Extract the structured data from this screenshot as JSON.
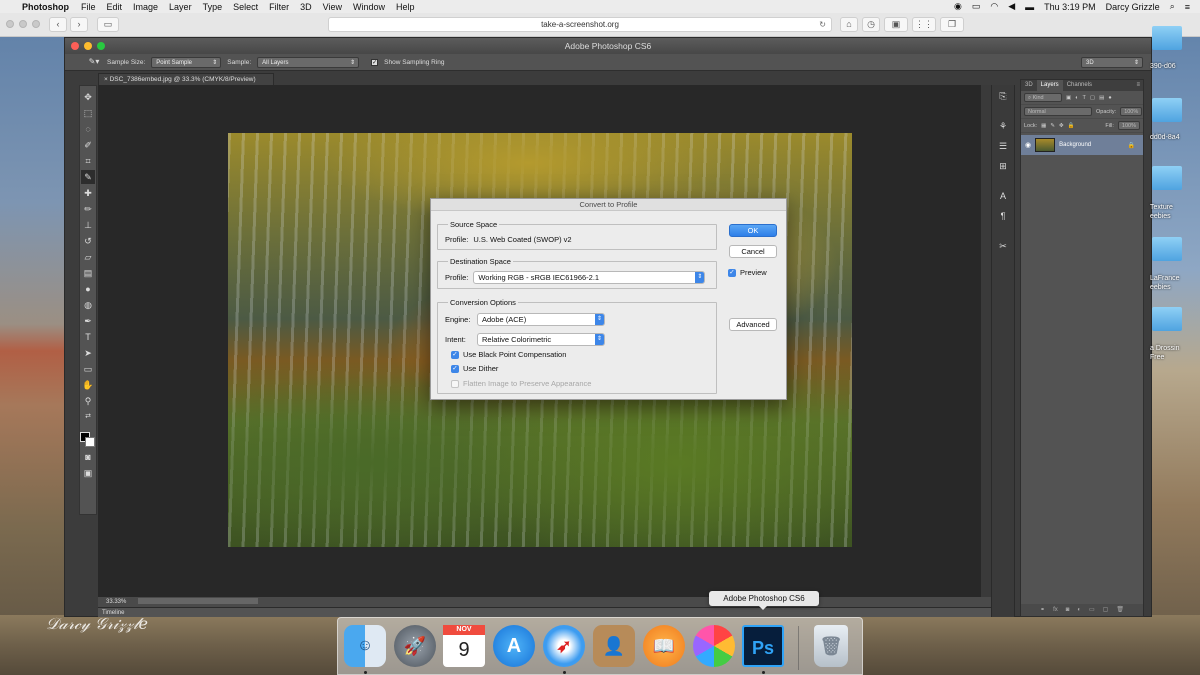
{
  "menubar": {
    "app": "Photoshop",
    "items": [
      "File",
      "Edit",
      "Image",
      "Layer",
      "Type",
      "Select",
      "Filter",
      "3D",
      "View",
      "Window",
      "Help"
    ],
    "clock": "Thu 3:19 PM",
    "user": "Darcy Grizzle"
  },
  "safari": {
    "url": "take-a-screenshot.org"
  },
  "photoshop": {
    "window_title": "Adobe Photoshop CS6",
    "options": {
      "sample_size_label": "Sample Size:",
      "sample_size_value": "Point Sample",
      "sample_label": "Sample:",
      "sample_value": "All Layers",
      "sampling_ring_label": "Show Sampling Ring",
      "workspace_value": "3D"
    },
    "doc_tab": "DSC_7386embed.jpg @ 33.3% (CMYK/8/Preview)",
    "zoom": "33.33%",
    "timeline_label": "Timeline",
    "layers_panel": {
      "tabs": [
        "3D",
        "Layers",
        "Channels"
      ],
      "kind_label": "Kind",
      "blend_mode": "Normal",
      "opacity_label": "Opacity:",
      "opacity_value": "100%",
      "lock_label": "Lock:",
      "fill_label": "Fill:",
      "fill_value": "100%",
      "layer_name": "Background"
    }
  },
  "dialog": {
    "title": "Convert to Profile",
    "source_space": {
      "label": "Source Space",
      "profile_label": "Profile:",
      "profile_value": "U.S. Web Coated (SWOP) v2"
    },
    "destination_space": {
      "label": "Destination Space",
      "profile_label": "Profile:",
      "profile_value": "Working RGB - sRGB IEC61966-2.1"
    },
    "conversion_options": {
      "label": "Conversion Options",
      "engine_label": "Engine:",
      "engine_value": "Adobe (ACE)",
      "intent_label": "Intent:",
      "intent_value": "Relative Colorimetric",
      "black_point_label": "Use Black Point Compensation",
      "dither_label": "Use Dither",
      "flatten_label": "Flatten Image to Preserve Appearance"
    },
    "ok_label": "OK",
    "cancel_label": "Cancel",
    "preview_label": "Preview",
    "advanced_label": "Advanced"
  },
  "dock": {
    "tooltip": "Adobe Photoshop CS6",
    "calendar_month": "NOV",
    "calendar_day": "9",
    "ps_label": "Ps"
  },
  "desktop": {
    "icon_labels": [
      "390-d06",
      "dd0d-8a4",
      "Texture",
      "eebies",
      "LaFrance",
      "eebies",
      "a Drossin",
      "Free"
    ],
    "signature": "Darcy Grizzle"
  },
  "colors": {
    "accent_blue": "#3d86e8",
    "ps_panel": "#535353",
    "ps_canvas": "#282828",
    "dialog_bg": "#ececec"
  }
}
